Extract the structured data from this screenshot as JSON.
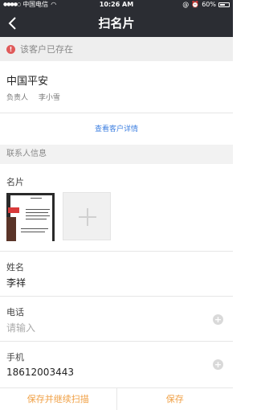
{
  "status_bar": {
    "carrier": "中国电信",
    "time": "10:26 AM",
    "battery": "60%"
  },
  "nav": {
    "title": "扫名片"
  },
  "alert": {
    "text": "该客户已存在"
  },
  "customer": {
    "name": "中国平安",
    "owner_label": "负责人",
    "owner_name": "李小雪",
    "detail_link": "查看客户详情"
  },
  "section": {
    "contact_info": "联系人信息"
  },
  "form": {
    "card_label": "名片",
    "name_label": "姓名",
    "name_value": "李祥",
    "phone_label": "电话",
    "phone_placeholder": "请输入",
    "mobile_label": "手机",
    "mobile_value": "18612003443"
  },
  "actions": {
    "save_continue": "保存并继续扫描",
    "save": "保存"
  },
  "colors": {
    "nav_bg": "#2b2d33",
    "action_text": "#f0a045",
    "link": "#3d7fe0",
    "alert_icon": "#e05a5a"
  }
}
